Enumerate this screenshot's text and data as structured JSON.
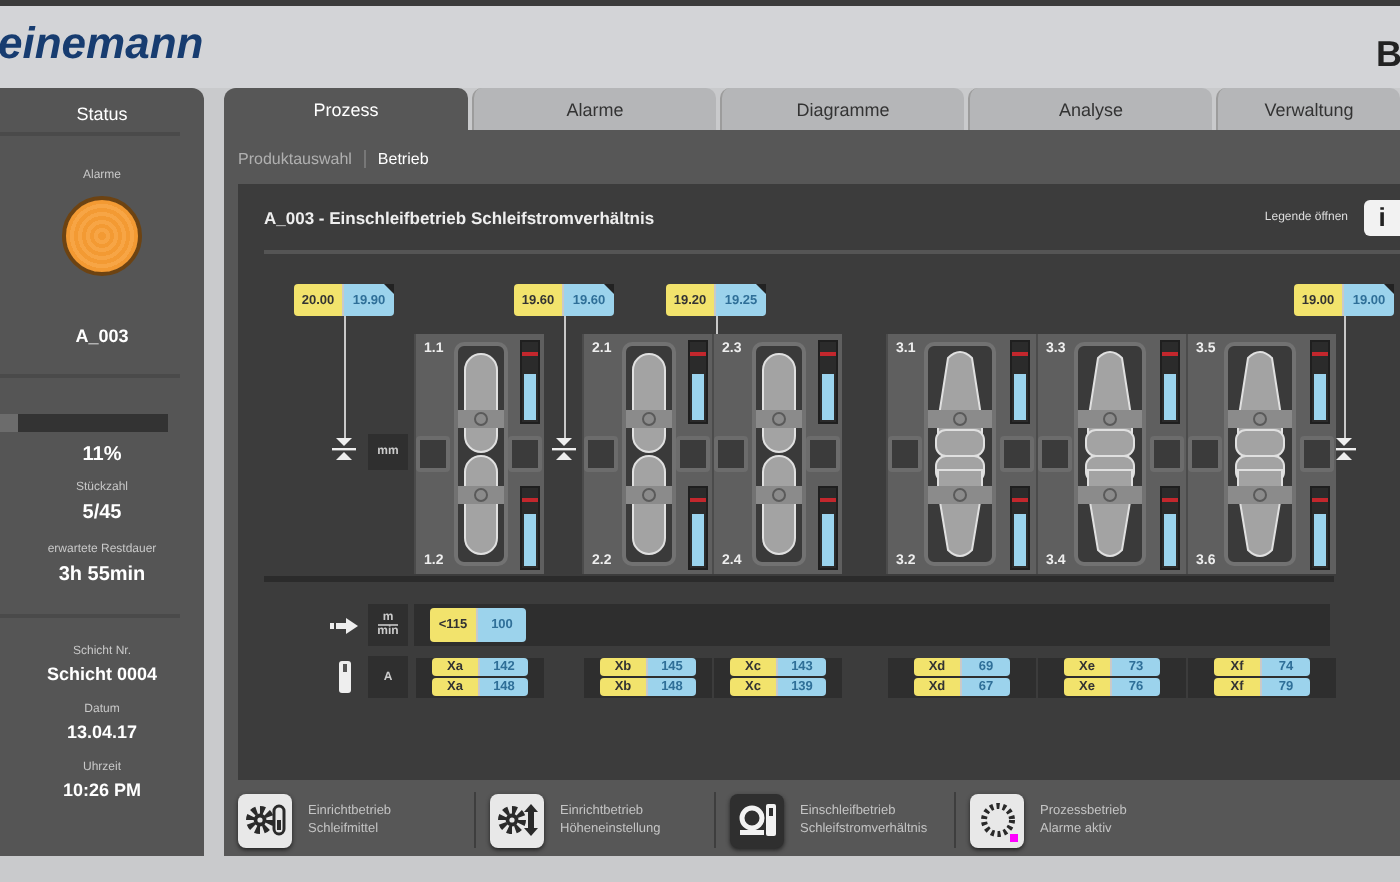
{
  "header": {
    "logo": "einemann",
    "corner_text": "B"
  },
  "status": {
    "title": "Status",
    "alarm_label": "Alarme",
    "alarm_active": true,
    "alarm_code": "A_003",
    "progress": {
      "level": 0.11,
      "reading": "11%"
    },
    "counters": [
      {
        "label": "Stückzahl",
        "value": "5/45"
      },
      {
        "label": "erwartete Restdauer",
        "value": "3h 55min"
      }
    ],
    "shift": [
      {
        "label": "Schicht Nr.",
        "value": "Schicht 0004"
      },
      {
        "label": "Datum",
        "value": "13.04.17"
      },
      {
        "label": "Uhrzeit",
        "value": "10:26 PM"
      }
    ]
  },
  "tabs": [
    {
      "label": "Prozess",
      "selected": true
    },
    {
      "label": "Alarme",
      "selected": false
    },
    {
      "label": "Diagramme",
      "selected": false
    },
    {
      "label": "Analyse",
      "selected": false
    },
    {
      "label": "Verwaltung",
      "selected": false
    }
  ],
  "breadcrumb": [
    {
      "label": "Produktauswahl",
      "selected": false
    },
    {
      "label": "Betrieb",
      "selected": true
    }
  ],
  "panel": {
    "title": "A_003 - Einschleifbetrieb Schleifstromverhältnis",
    "legend_label": "Legende öffnen",
    "info_button": "i",
    "measure_unit": "mm",
    "measurements": [
      {
        "setpoint": "20.00",
        "actual": "19.90"
      },
      {
        "setpoint": "19.60",
        "actual": "19.60"
      },
      {
        "setpoint": "19.20",
        "actual": "19.25"
      },
      {
        "setpoint": "19.00",
        "actual": "19.00"
      }
    ],
    "station_groups": [
      {
        "stations": [
          {
            "kind": "split",
            "top_label": "1.1",
            "bottom_label": "1.2",
            "top_meter": {
              "level": 0.6
            },
            "bottom_meter": {
              "level": 0.68
            }
          }
        ]
      },
      {
        "stations": [
          {
            "kind": "split",
            "top_label": "2.1",
            "bottom_label": "2.2",
            "top_meter": {
              "level": 0.6
            },
            "bottom_meter": {
              "level": 0.68
            }
          },
          {
            "kind": "split",
            "top_label": "2.3",
            "bottom_label": "2.4",
            "top_meter": {
              "level": 0.6
            },
            "bottom_meter": {
              "level": 0.68
            }
          }
        ]
      },
      {
        "stations": [
          {
            "kind": "tapered",
            "top_label": "3.1",
            "bottom_label": "3.2",
            "top_meter": {
              "level": 0.6
            },
            "bottom_meter": {
              "level": 0.68
            }
          },
          {
            "kind": "tapered",
            "top_label": "3.3",
            "bottom_label": "3.4",
            "top_meter": {
              "level": 0.6
            },
            "bottom_meter": {
              "level": 0.68
            }
          },
          {
            "kind": "tapered",
            "top_label": "3.5",
            "bottom_label": "3.6",
            "top_meter": {
              "level": 0.6
            },
            "bottom_meter": {
              "level": 0.68
            }
          }
        ]
      }
    ],
    "speed_row": {
      "unit_top": "m",
      "unit_bottom": "min",
      "setpoint": "<115",
      "actual": "100"
    },
    "current_row": {
      "unit": "A",
      "groups": [
        {
          "rows": [
            {
              "name": "Xa",
              "value": "142"
            },
            {
              "name": "Xa",
              "value": "148"
            }
          ]
        },
        {
          "rows": [
            {
              "name": "Xb",
              "value": "145"
            },
            {
              "name": "Xb",
              "value": "148"
            }
          ]
        },
        {
          "rows": [
            {
              "name": "Xc",
              "value": "143"
            },
            {
              "name": "Xc",
              "value": "139"
            }
          ]
        },
        {
          "rows": [
            {
              "name": "Xd",
              "value": "69"
            },
            {
              "name": "Xd",
              "value": "67"
            }
          ]
        },
        {
          "rows": [
            {
              "name": "Xe",
              "value": "73"
            },
            {
              "name": "Xe",
              "value": "76"
            }
          ]
        },
        {
          "rows": [
            {
              "name": "Xf",
              "value": "74"
            },
            {
              "name": "Xf",
              "value": "79"
            }
          ]
        }
      ]
    }
  },
  "modes": [
    {
      "kind": "gear-abrasive",
      "title": "Einrichtbetrieb",
      "subtitle": "Schleifmittel",
      "selected": false,
      "alarm": false
    },
    {
      "kind": "gear-height",
      "title": "Einrichtbetrieb",
      "subtitle": "Höheneinstellung",
      "selected": false,
      "alarm": false
    },
    {
      "kind": "roll-abrasive",
      "title": "Einschleifbetrieb",
      "subtitle": "Schleifstromverhältnis",
      "selected": true,
      "alarm": false
    },
    {
      "kind": "process",
      "title": "Prozessbetrieb",
      "subtitle": "Alarme aktiv",
      "selected": false,
      "alarm": true
    }
  ]
}
